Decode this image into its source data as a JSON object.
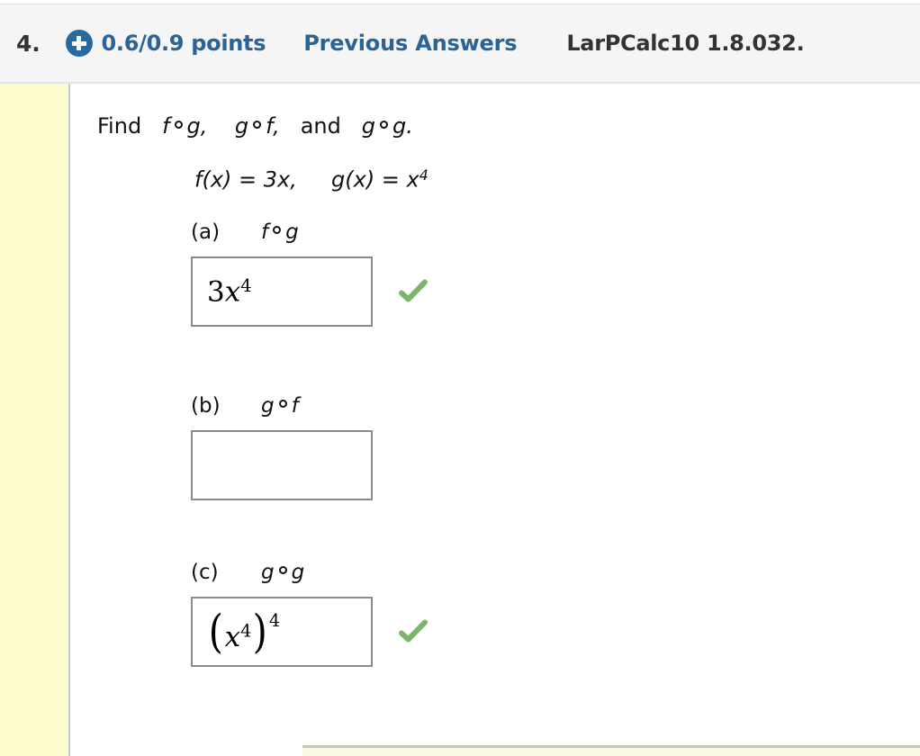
{
  "header": {
    "question_number": "4.",
    "plus_icon": "plus-circle-icon",
    "points": "0.6/0.9 points",
    "previous_answers": "Previous Answers",
    "textbook_reference": "LarPCalc10 1.8.032.",
    "link_color": "#2a6496",
    "badge_color": "#28699e",
    "background": "#f5f5f5"
  },
  "sidebar": {
    "color": "#fcfbce"
  },
  "question": {
    "prompt_lead": "Find",
    "prompt_item1_left": "f",
    "prompt_item1_right": "g,",
    "prompt_item2_left": "g",
    "prompt_item2_right": "f,",
    "prompt_conj": "and",
    "prompt_item3_left": "g",
    "prompt_item3_right": "g.",
    "definition_f": "f(x) = 3x,",
    "definition_g_base": "g(x) = x",
    "definition_g_exp": "4"
  },
  "parts": {
    "a": {
      "label": "(a)",
      "expr_left": "f",
      "expr_right": "g",
      "answer": {
        "coefficient": "3",
        "variable": "x",
        "exponent": "4"
      },
      "status": "correct",
      "status_icon": "green-check-icon"
    },
    "b": {
      "label": "(b)",
      "expr_left": "g",
      "expr_right": "f",
      "answer": {
        "value": ""
      },
      "status": "unanswered"
    },
    "c": {
      "label": "(c)",
      "expr_left": "g",
      "expr_right": "g",
      "answer": {
        "open_paren": "(",
        "variable": "x",
        "inner_exponent": "4",
        "close_paren": ")",
        "outer_exponent": "4"
      },
      "status": "correct",
      "status_icon": "green-check-icon"
    }
  },
  "colors": {
    "check_green": "#7cb46a",
    "box_border": "#8a8a8a",
    "text": "#111111"
  }
}
